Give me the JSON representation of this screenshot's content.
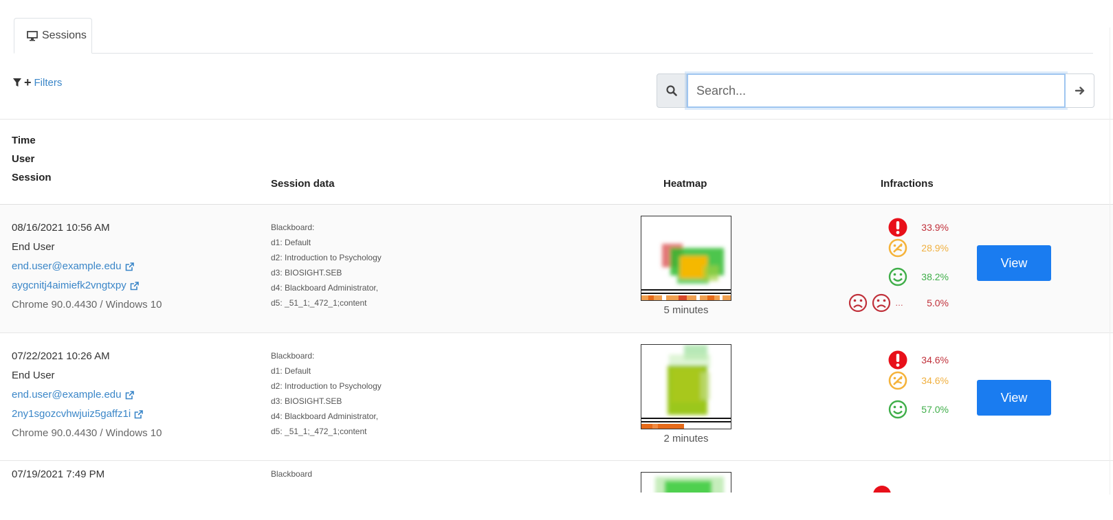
{
  "tabs": [
    {
      "label": "Sessions",
      "icon": "desktop-icon"
    }
  ],
  "filters": {
    "label": "Filters"
  },
  "search": {
    "placeholder": "Search..."
  },
  "table": {
    "headers": {
      "col1": [
        "Time",
        "User",
        "Session"
      ],
      "session_data": "Session data",
      "heatmap": "Heatmap",
      "infractions": "Infractions"
    },
    "rows": [
      {
        "time": "08/16/2021 10:56 AM",
        "user": "End User",
        "email": "end.user@example.edu",
        "session_id": "aygcnitj4aimiefk2vngtxpy",
        "browser": "Chrome 90.0.4430 / Windows 10",
        "session_data": [
          "Blackboard:",
          "d1: Default",
          "d2: Introduction to Psychology",
          "d3: BIOSIGHT.SEB",
          "d4: Blackboard Administrator,",
          "d5: _51_1;_472_1;content"
        ],
        "heatmap_label": "5 minutes",
        "infractions": {
          "alert": "33.9%",
          "neutral": "28.9%",
          "happy": "38.2%",
          "sad": "5.0%"
        },
        "view_label": "View"
      },
      {
        "time": "07/22/2021 10:26 AM",
        "user": "End User",
        "email": "end.user@example.edu",
        "session_id": "2ny1sgozcvhwjuiz5gaffz1i",
        "browser": "Chrome 90.0.4430 / Windows 10",
        "session_data": [
          "Blackboard:",
          "d1: Default",
          "d2: Introduction to Psychology",
          "d3: BIOSIGHT.SEB",
          "d4: Blackboard Administrator,",
          "d5: _51_1;_472_1;content"
        ],
        "heatmap_label": "2 minutes",
        "infractions": {
          "alert": "34.6%",
          "neutral": "34.6%",
          "happy": "57.0%"
        },
        "view_label": "View"
      },
      {
        "time": "07/19/2021 7:49 PM",
        "session_data": [
          "Blackboard"
        ]
      }
    ]
  },
  "colors": {
    "link": "#3a86c8",
    "primary": "#1a7cf0",
    "alert": "#e8101a",
    "neutral": "#f5b33a",
    "happy": "#3fae49",
    "sad": "#c0303a"
  }
}
